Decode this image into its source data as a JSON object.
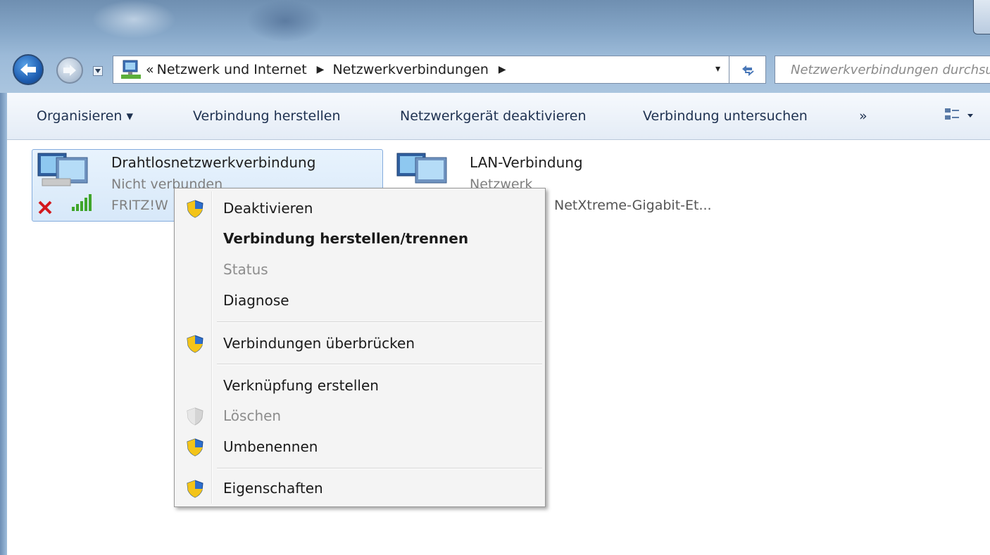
{
  "address_bar": {
    "overflow_chevron": "«",
    "crumbs": [
      "Netzwerk und Internet",
      "Netzwerkverbindungen"
    ],
    "separator": "▶",
    "dropdown": "▾"
  },
  "search": {
    "placeholder": "Netzwerkverbindungen durchsuchen"
  },
  "toolbar": {
    "organize": "Organisieren ▾",
    "connect": "Verbindung herstellen",
    "disable": "Netzwerkgerät deaktivieren",
    "diagnose": "Verbindung untersuchen",
    "more": "»"
  },
  "items": [
    {
      "title": "Drahtlosnetzwerkverbindung",
      "status": "Nicht verbunden",
      "device": "FRITZ!W"
    },
    {
      "title": "LAN-Verbindung",
      "status": "Netzwerk",
      "device": "NetXtreme-Gigabit-Et..."
    }
  ],
  "context_menu": {
    "items": [
      {
        "label": "Deaktivieren",
        "shield": true
      },
      {
        "label": "Verbindung herstellen/trennen",
        "bold": true
      },
      {
        "label": "Status",
        "disabled": true
      },
      {
        "label": "Diagnose"
      },
      {
        "label": "Verbindungen überbrücken",
        "shield": true
      },
      {
        "label": "Verknüpfung erstellen"
      },
      {
        "label": "Löschen",
        "disabled": true,
        "shield": true
      },
      {
        "label": "Umbenennen",
        "shield": true
      },
      {
        "label": "Eigenschaften",
        "shield": true
      }
    ]
  },
  "colors": {
    "toolbar_text": "#1e3150",
    "selection_bg": "#d7e8f9",
    "selection_border": "#84acdd",
    "menu_bg": "#f4f4f4",
    "disabled_text": "#8d8d8d"
  },
  "icons": {
    "back": "back-arrow-icon",
    "forward": "forward-arrow-icon",
    "refresh": "refresh-icon",
    "network_folder": "network-folder-icon",
    "computer": "network-computer-icon",
    "shield": "uac-shield-icon",
    "disconnected": "red-x-icon",
    "signal": "signal-bars-icon",
    "view": "view-options-icon"
  }
}
